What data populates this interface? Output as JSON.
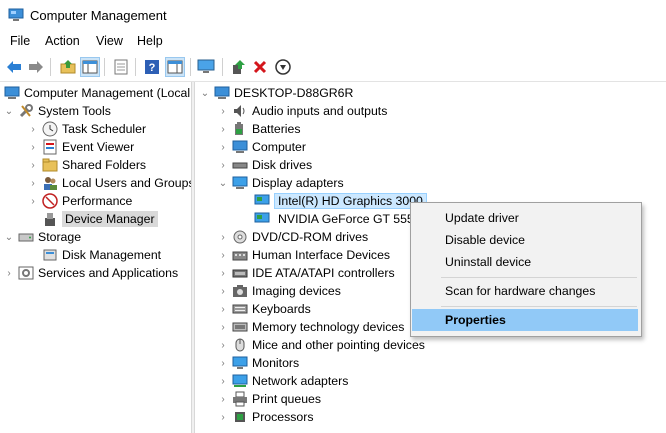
{
  "window": {
    "title": "Computer Management"
  },
  "menu": [
    "File",
    "Action",
    "View",
    "Help"
  ],
  "toolbar": {
    "icons": [
      "back-icon",
      "forward-icon",
      "up-folder-icon",
      "show-hide-tree-icon",
      "export-list-icon",
      "help-icon",
      "action-pane-icon",
      "monitor-icon",
      "update-driver-icon",
      "uninstall-icon",
      "disable-device-icon"
    ]
  },
  "left_tree": {
    "root": "Computer Management (Local",
    "system_tools": "System Tools",
    "task_scheduler": "Task Scheduler",
    "event_viewer": "Event Viewer",
    "shared_folders": "Shared Folders",
    "local_users": "Local Users and Groups",
    "performance": "Performance",
    "device_manager": "Device Manager",
    "storage": "Storage",
    "disk_management": "Disk Management",
    "services": "Services and Applications"
  },
  "device_tree": {
    "root": "DESKTOP-D88GR6R",
    "items": [
      "Audio inputs and outputs",
      "Batteries",
      "Computer",
      "Disk drives",
      "Display adapters",
      "Intel(R) HD Graphics 3000",
      "NVIDIA GeForce GT 555M",
      "DVD/CD-ROM drives",
      "Human Interface Devices",
      "IDE ATA/ATAPI controllers",
      "Imaging devices",
      "Keyboards",
      "Memory technology devices",
      "Mice and other pointing devices",
      "Monitors",
      "Network adapters",
      "Print queues",
      "Processors"
    ]
  },
  "context_menu": {
    "update_driver": "Update driver",
    "disable_device": "Disable device",
    "uninstall_device": "Uninstall device",
    "scan_changes": "Scan for hardware changes",
    "properties": "Properties"
  },
  "colors": {
    "accent": "#91c9f7",
    "selection": "#cce8ff"
  }
}
